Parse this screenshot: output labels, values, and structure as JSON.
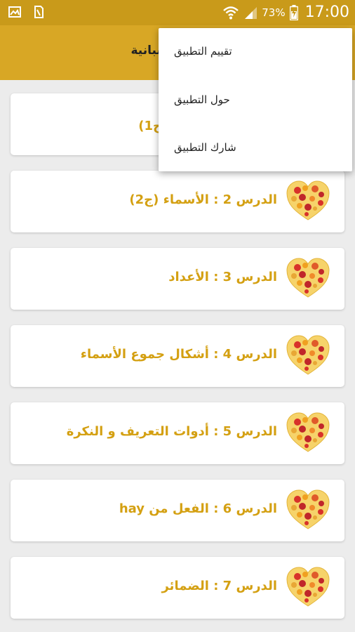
{
  "status_bar": {
    "left_icons": [
      "gallery-icon",
      "sim-card-icon"
    ],
    "right_icons": [
      "wifi-icon",
      "signal-icon",
      "battery-charging-icon"
    ],
    "battery": "73%",
    "time": "17:00"
  },
  "app_bar": {
    "title": "إسبانية",
    "color": "#d8a725"
  },
  "overflow_menu": {
    "items": [
      "تقييم التطبيق",
      "حول التطبيق",
      "شارك التطبيق"
    ]
  },
  "lessons": [
    {
      "label": "ج1)",
      "icon": "heart-spain-icon"
    },
    {
      "label": "الدرس 2 : الأسماء (ج2)",
      "icon": "heart-spain-icon"
    },
    {
      "label": "الدرس 3 : الأعداد",
      "icon": "heart-spain-icon"
    },
    {
      "label": "الدرس 4 : أشكال جموع الأسماء",
      "icon": "heart-spain-icon"
    },
    {
      "label": "الدرس 5 : أدوات التعريف و النكرة",
      "icon": "heart-spain-icon"
    },
    {
      "label": "الدرس 6 : الفعل من hay",
      "icon": "heart-spain-icon"
    },
    {
      "label": "الدرس 7 : الضمائر",
      "icon": "heart-spain-icon"
    }
  ],
  "colors": {
    "status_bar": "#c99a1a",
    "accent_text": "#d4a012",
    "background": "#ececec"
  }
}
